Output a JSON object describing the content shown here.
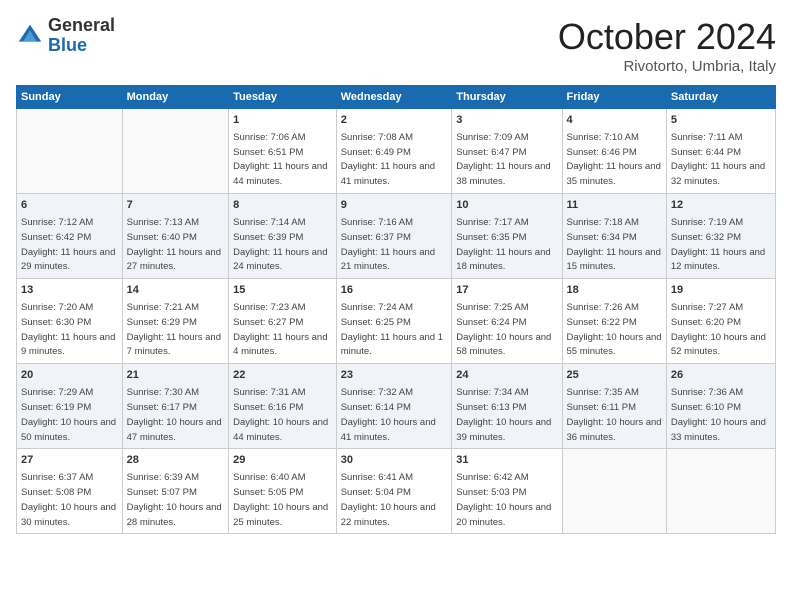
{
  "header": {
    "logo_general": "General",
    "logo_blue": "Blue",
    "month_title": "October 2024",
    "location": "Rivotorto, Umbria, Italy"
  },
  "days_of_week": [
    "Sunday",
    "Monday",
    "Tuesday",
    "Wednesday",
    "Thursday",
    "Friday",
    "Saturday"
  ],
  "weeks": [
    [
      {
        "day": "",
        "info": ""
      },
      {
        "day": "",
        "info": ""
      },
      {
        "day": "1",
        "info": "Sunrise: 7:06 AM\nSunset: 6:51 PM\nDaylight: 11 hours and 44 minutes."
      },
      {
        "day": "2",
        "info": "Sunrise: 7:08 AM\nSunset: 6:49 PM\nDaylight: 11 hours and 41 minutes."
      },
      {
        "day": "3",
        "info": "Sunrise: 7:09 AM\nSunset: 6:47 PM\nDaylight: 11 hours and 38 minutes."
      },
      {
        "day": "4",
        "info": "Sunrise: 7:10 AM\nSunset: 6:46 PM\nDaylight: 11 hours and 35 minutes."
      },
      {
        "day": "5",
        "info": "Sunrise: 7:11 AM\nSunset: 6:44 PM\nDaylight: 11 hours and 32 minutes."
      }
    ],
    [
      {
        "day": "6",
        "info": "Sunrise: 7:12 AM\nSunset: 6:42 PM\nDaylight: 11 hours and 29 minutes."
      },
      {
        "day": "7",
        "info": "Sunrise: 7:13 AM\nSunset: 6:40 PM\nDaylight: 11 hours and 27 minutes."
      },
      {
        "day": "8",
        "info": "Sunrise: 7:14 AM\nSunset: 6:39 PM\nDaylight: 11 hours and 24 minutes."
      },
      {
        "day": "9",
        "info": "Sunrise: 7:16 AM\nSunset: 6:37 PM\nDaylight: 11 hours and 21 minutes."
      },
      {
        "day": "10",
        "info": "Sunrise: 7:17 AM\nSunset: 6:35 PM\nDaylight: 11 hours and 18 minutes."
      },
      {
        "day": "11",
        "info": "Sunrise: 7:18 AM\nSunset: 6:34 PM\nDaylight: 11 hours and 15 minutes."
      },
      {
        "day": "12",
        "info": "Sunrise: 7:19 AM\nSunset: 6:32 PM\nDaylight: 11 hours and 12 minutes."
      }
    ],
    [
      {
        "day": "13",
        "info": "Sunrise: 7:20 AM\nSunset: 6:30 PM\nDaylight: 11 hours and 9 minutes."
      },
      {
        "day": "14",
        "info": "Sunrise: 7:21 AM\nSunset: 6:29 PM\nDaylight: 11 hours and 7 minutes."
      },
      {
        "day": "15",
        "info": "Sunrise: 7:23 AM\nSunset: 6:27 PM\nDaylight: 11 hours and 4 minutes."
      },
      {
        "day": "16",
        "info": "Sunrise: 7:24 AM\nSunset: 6:25 PM\nDaylight: 11 hours and 1 minute."
      },
      {
        "day": "17",
        "info": "Sunrise: 7:25 AM\nSunset: 6:24 PM\nDaylight: 10 hours and 58 minutes."
      },
      {
        "day": "18",
        "info": "Sunrise: 7:26 AM\nSunset: 6:22 PM\nDaylight: 10 hours and 55 minutes."
      },
      {
        "day": "19",
        "info": "Sunrise: 7:27 AM\nSunset: 6:20 PM\nDaylight: 10 hours and 52 minutes."
      }
    ],
    [
      {
        "day": "20",
        "info": "Sunrise: 7:29 AM\nSunset: 6:19 PM\nDaylight: 10 hours and 50 minutes."
      },
      {
        "day": "21",
        "info": "Sunrise: 7:30 AM\nSunset: 6:17 PM\nDaylight: 10 hours and 47 minutes."
      },
      {
        "day": "22",
        "info": "Sunrise: 7:31 AM\nSunset: 6:16 PM\nDaylight: 10 hours and 44 minutes."
      },
      {
        "day": "23",
        "info": "Sunrise: 7:32 AM\nSunset: 6:14 PM\nDaylight: 10 hours and 41 minutes."
      },
      {
        "day": "24",
        "info": "Sunrise: 7:34 AM\nSunset: 6:13 PM\nDaylight: 10 hours and 39 minutes."
      },
      {
        "day": "25",
        "info": "Sunrise: 7:35 AM\nSunset: 6:11 PM\nDaylight: 10 hours and 36 minutes."
      },
      {
        "day": "26",
        "info": "Sunrise: 7:36 AM\nSunset: 6:10 PM\nDaylight: 10 hours and 33 minutes."
      }
    ],
    [
      {
        "day": "27",
        "info": "Sunrise: 6:37 AM\nSunset: 5:08 PM\nDaylight: 10 hours and 30 minutes."
      },
      {
        "day": "28",
        "info": "Sunrise: 6:39 AM\nSunset: 5:07 PM\nDaylight: 10 hours and 28 minutes."
      },
      {
        "day": "29",
        "info": "Sunrise: 6:40 AM\nSunset: 5:05 PM\nDaylight: 10 hours and 25 minutes."
      },
      {
        "day": "30",
        "info": "Sunrise: 6:41 AM\nSunset: 5:04 PM\nDaylight: 10 hours and 22 minutes."
      },
      {
        "day": "31",
        "info": "Sunrise: 6:42 AM\nSunset: 5:03 PM\nDaylight: 10 hours and 20 minutes."
      },
      {
        "day": "",
        "info": ""
      },
      {
        "day": "",
        "info": ""
      }
    ]
  ]
}
